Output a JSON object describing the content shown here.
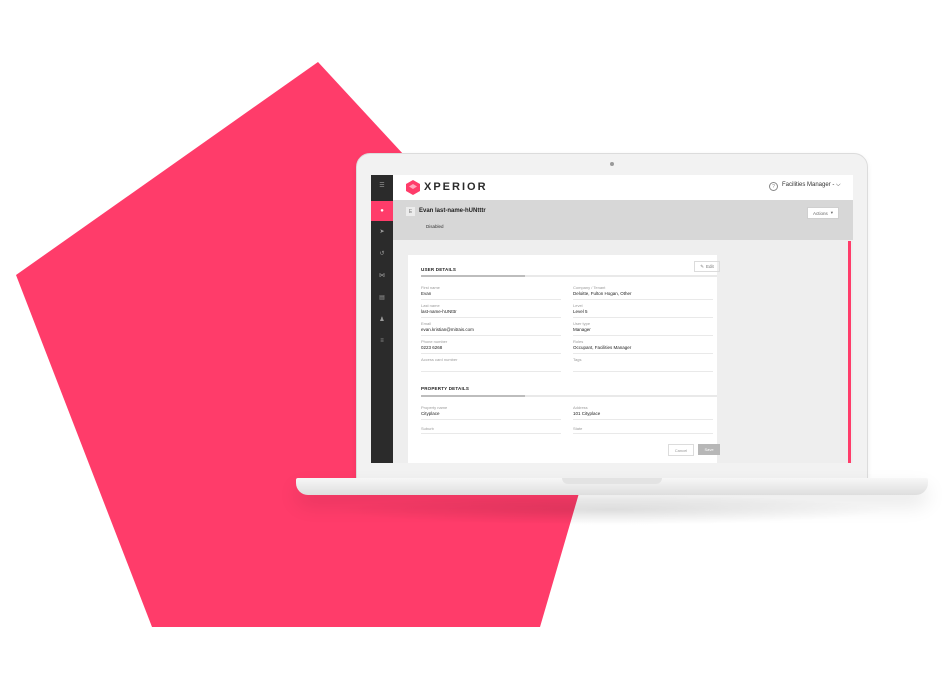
{
  "colors": {
    "accent": "#ff3c6a",
    "sidebar": "#2b2b2b",
    "band": "#d7d7d7"
  },
  "app": {
    "logo_text": "XPERIOR",
    "role_label": "Facilities Manager -",
    "role_chevron": "⌵"
  },
  "sidebar": {
    "items": [
      {
        "icon": "menu-icon",
        "glyph": "☰"
      },
      {
        "icon": "user-icon",
        "glyph": "●"
      },
      {
        "icon": "send-icon",
        "glyph": "➤"
      },
      {
        "icon": "history-icon",
        "glyph": "↺"
      },
      {
        "icon": "share-icon",
        "glyph": "⋈"
      },
      {
        "icon": "document-icon",
        "glyph": "▤"
      },
      {
        "icon": "group-icon",
        "glyph": "♟"
      },
      {
        "icon": "list-icon",
        "glyph": "≡"
      }
    ]
  },
  "user": {
    "avatar": "E",
    "title": "Evan last-name-hUNtttr",
    "status": "Disabled",
    "actions_label": "Actions",
    "actions_caret": "▾"
  },
  "card": {
    "edit_label": "Edit",
    "edit_icon_glyph": "✎",
    "user_details_title": "USER DETAILS",
    "property_details_title": "PROPERTY DETAILS",
    "user_fields": [
      {
        "label": "First name",
        "value": "Evan"
      },
      {
        "label": "Company / Tenant",
        "value": "Deloitte, Fulton Hogan, Other"
      },
      {
        "label": "Last name",
        "value": "last-name-hUNtttr"
      },
      {
        "label": "Level",
        "value": "Level 5"
      },
      {
        "label": "Email",
        "value": "evan.kristian@mitrais.com"
      },
      {
        "label": "User type",
        "value": "Manager"
      },
      {
        "label": "Phone number",
        "value": "0223 6268"
      },
      {
        "label": "Roles",
        "value": "Occupant, Facilities Manager"
      },
      {
        "label": "Access card number",
        "value": ""
      },
      {
        "label": "Tags",
        "value": ""
      }
    ],
    "property_fields": [
      {
        "label": "Property name",
        "value": "Cityplace"
      },
      {
        "label": "Address",
        "value": "101 Cityplace"
      },
      {
        "label": "Suburb",
        "value": ""
      },
      {
        "label": "State",
        "value": ""
      }
    ],
    "cancel_label": "Cancel",
    "save_label": "Save"
  }
}
